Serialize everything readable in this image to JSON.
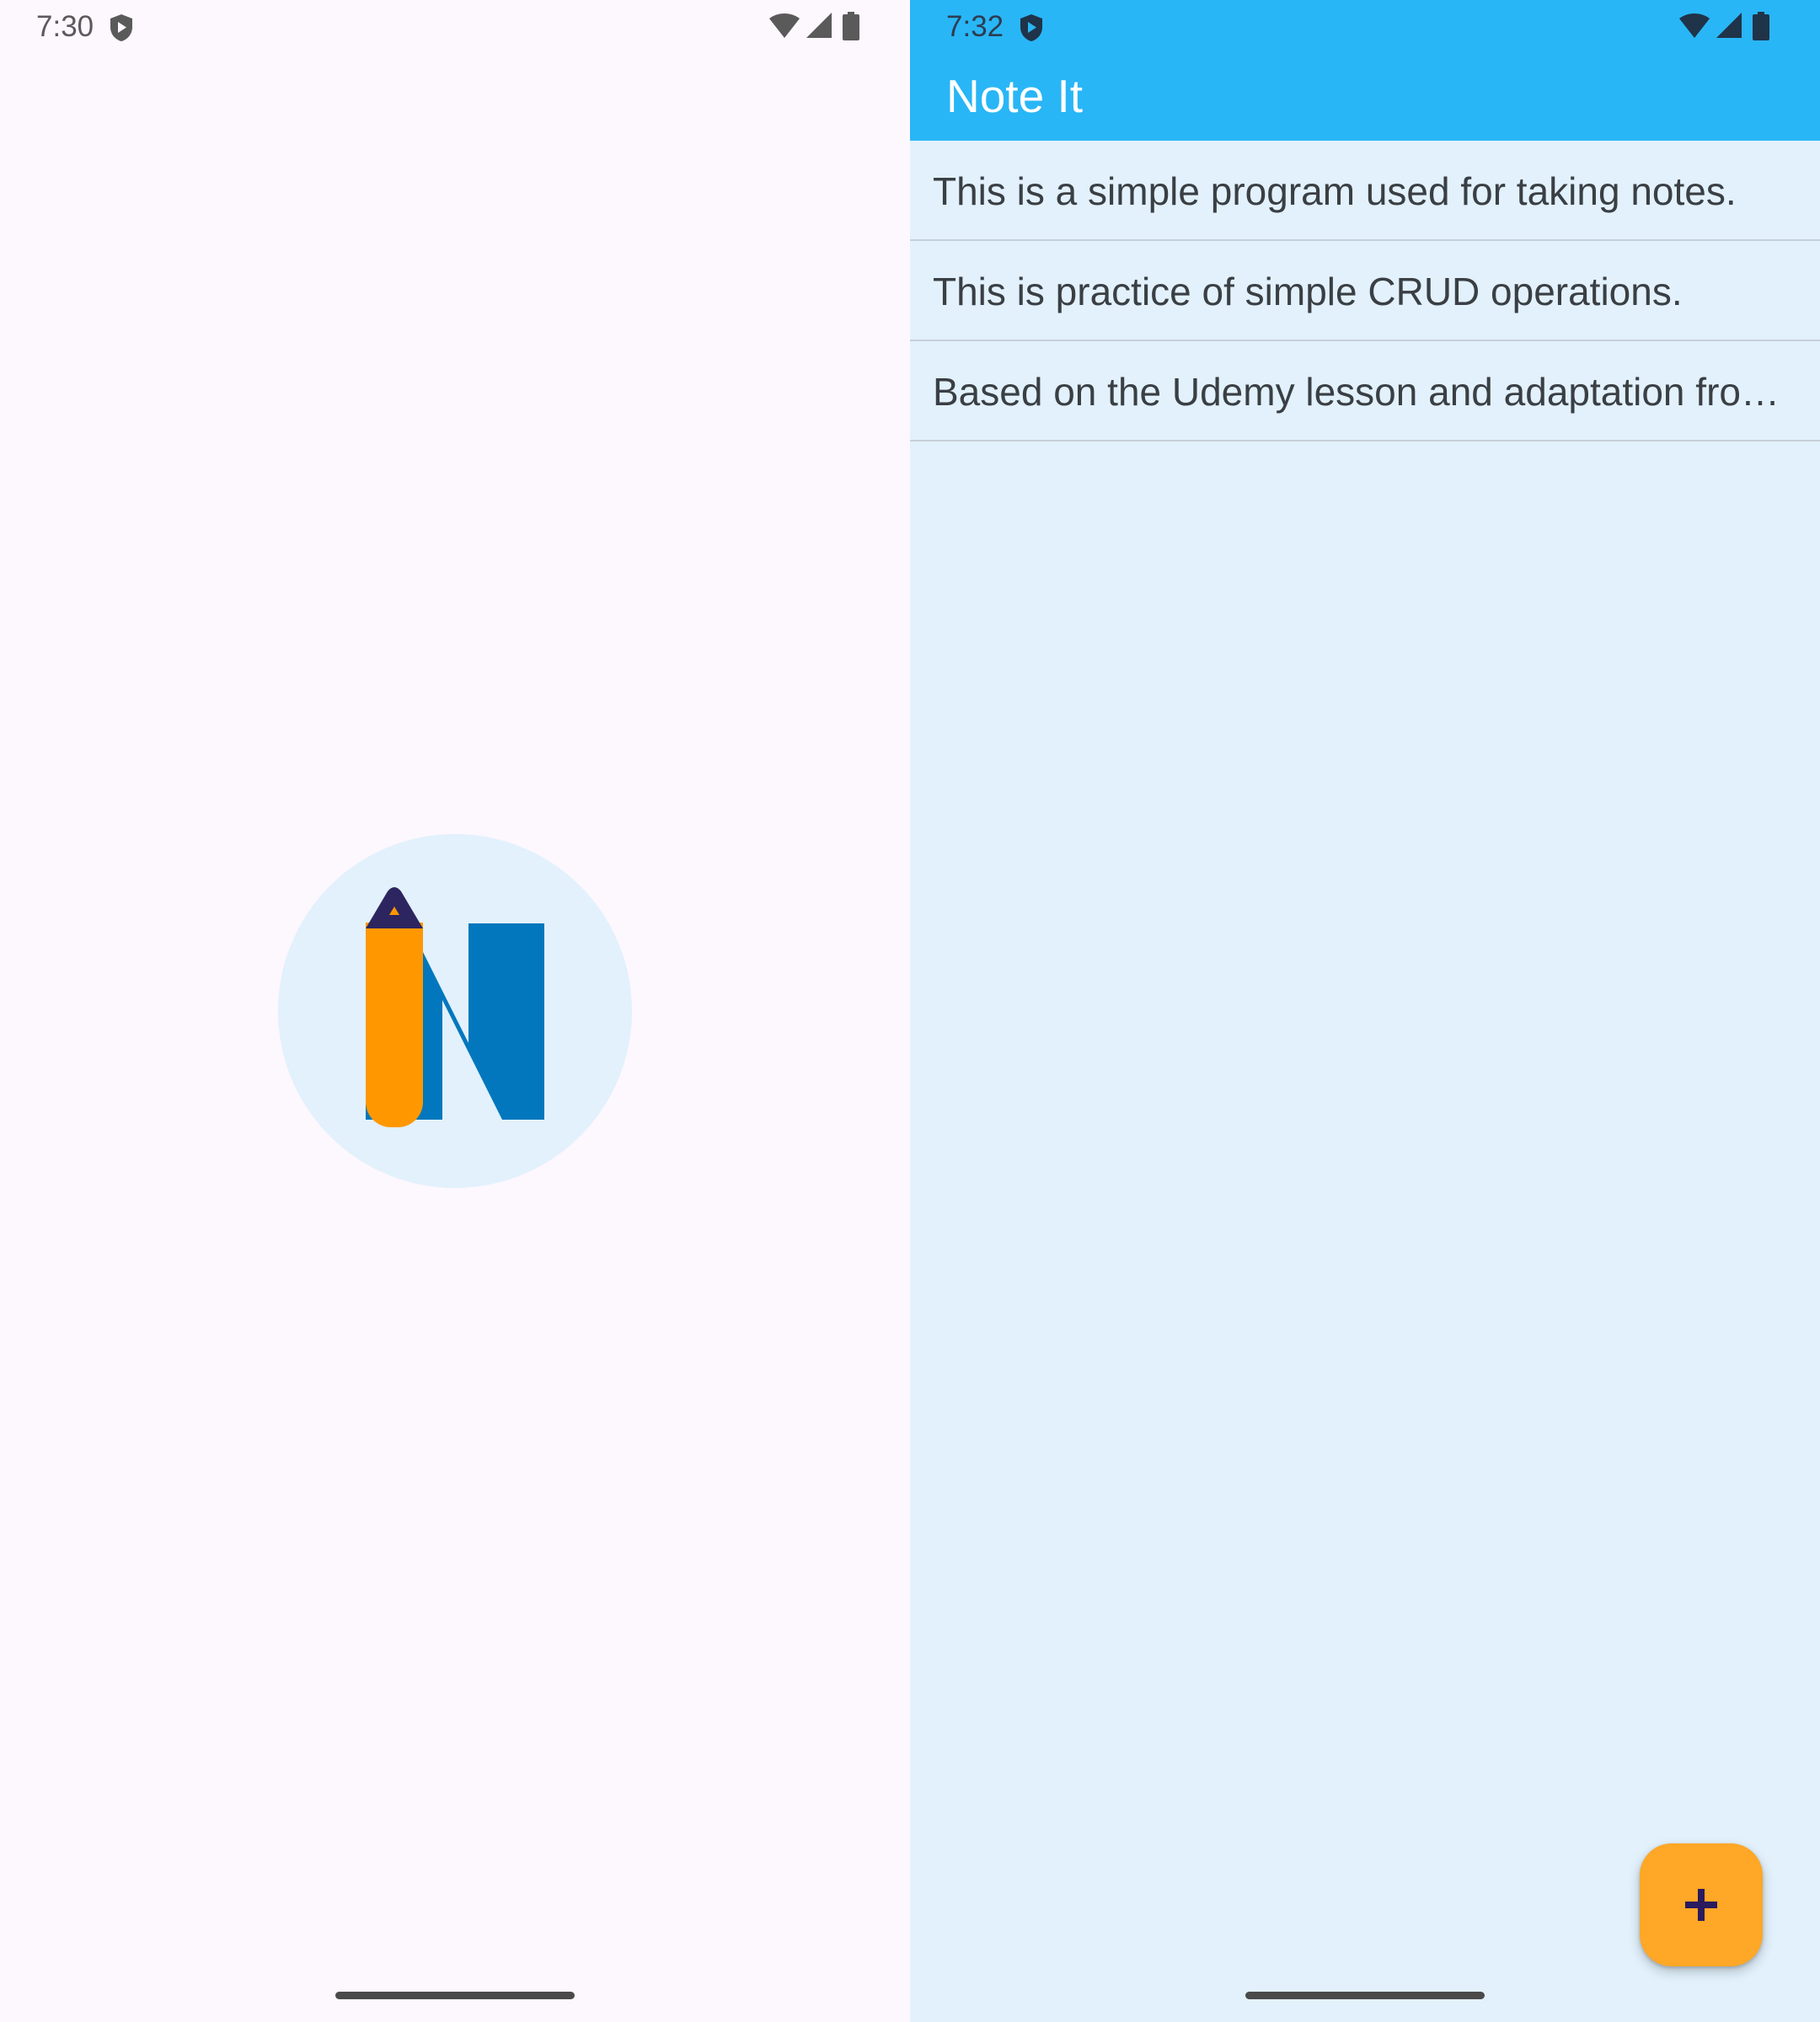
{
  "splash_screen": {
    "status_bar": {
      "time": "7:30"
    },
    "logo": {
      "icon": "note-it-logo-icon",
      "letter": "N",
      "colors": {
        "circle": "#e2f1fc",
        "pencil": "#ff9800",
        "pencil_tip": "#2d2560",
        "letter": "#0277bd"
      }
    },
    "background": "#fdf7fe"
  },
  "main_screen": {
    "status_bar": {
      "time": "7:32"
    },
    "app_bar": {
      "title": "Note It",
      "color": "#29b6f6"
    },
    "notes": [
      {
        "text": "This is a simple program used for taking notes."
      },
      {
        "text": "This is practice of simple CRUD operations."
      },
      {
        "text": "Based on the Udemy lesson and adaptation from the course project."
      }
    ],
    "fab": {
      "icon": "plus-icon",
      "color": "#ffa726"
    },
    "background": "#e2f1fc"
  }
}
